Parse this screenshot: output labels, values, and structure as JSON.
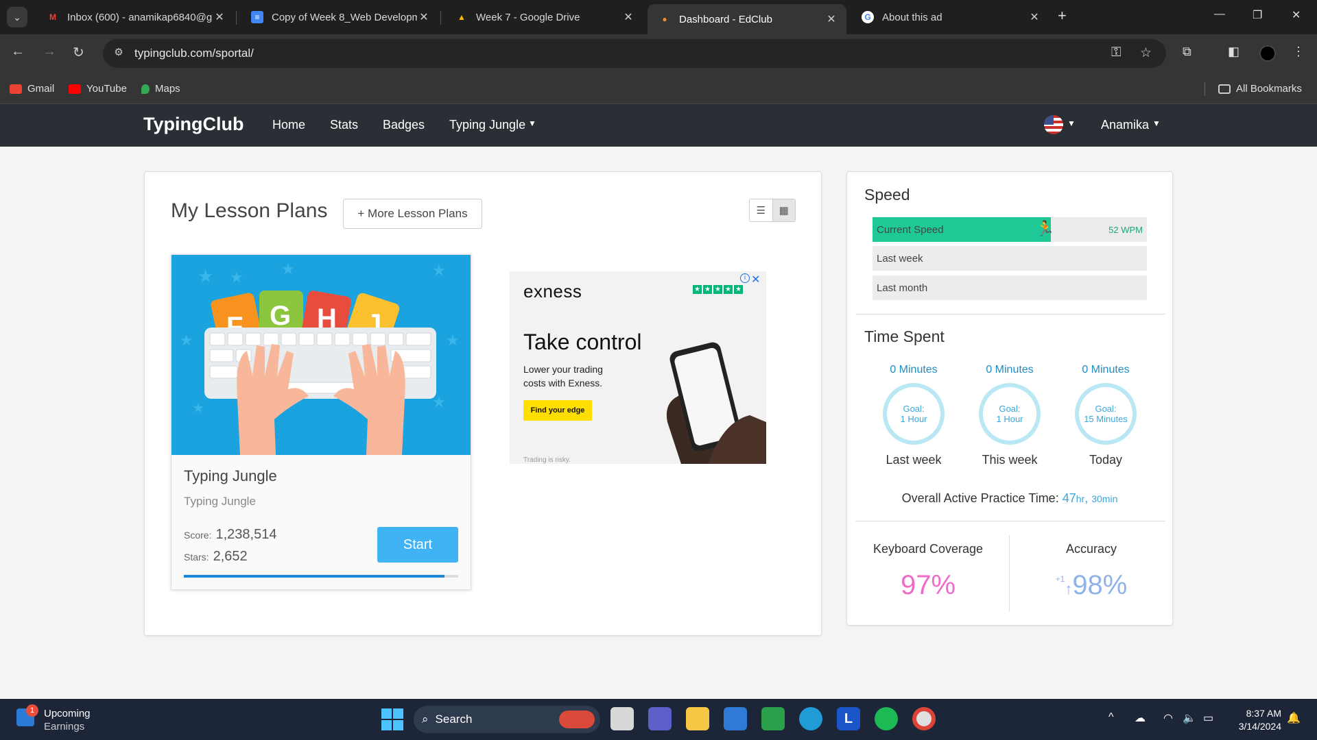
{
  "browser": {
    "tabs": [
      {
        "title": "Inbox (600) - anamikap6840@g",
        "icon": "gmail-icon"
      },
      {
        "title": "Copy of Week 8_Web Developm",
        "icon": "docs-icon"
      },
      {
        "title": "Week 7 - Google Drive",
        "icon": "drive-icon"
      },
      {
        "title": "Dashboard - EdClub",
        "icon": "edclub-icon",
        "active": true
      },
      {
        "title": "About this ad",
        "icon": "google-icon"
      }
    ],
    "url": "typingclub.com/sportal/",
    "bookmarks": [
      {
        "label": "Gmail"
      },
      {
        "label": "YouTube"
      },
      {
        "label": "Maps"
      }
    ],
    "all_bookmarks": "All Bookmarks"
  },
  "site": {
    "brand": "TypingClub",
    "nav": [
      "Home",
      "Stats",
      "Badges",
      "Typing Jungle"
    ],
    "user": "Anamika"
  },
  "lesson_plans": {
    "title": "My Lesson Plans",
    "more_button": "+ More Lesson Plans",
    "plan": {
      "name": "Typing Jungle",
      "subtitle": "Typing Jungle",
      "score_label": "Score:",
      "score": "1,238,514",
      "stars_label": "Stars:",
      "stars": "2,652",
      "start_button": "Start",
      "progress": 0.95,
      "tile_letters": [
        "F",
        "G",
        "H",
        "J"
      ]
    }
  },
  "ad": {
    "brand": "exness",
    "headline": "Take control",
    "text": "Lower your trading costs with Exness.",
    "cta": "Find your edge",
    "fine_print": "Trading is risky."
  },
  "speed": {
    "title": "Speed",
    "bars": [
      {
        "label": "Current Speed",
        "value": "52 WPM",
        "fill": 0.65
      },
      {
        "label": "Last week",
        "value": "",
        "fill": 0
      },
      {
        "label": "Last month",
        "value": "",
        "fill": 0
      }
    ]
  },
  "time_spent": {
    "title": "Time Spent",
    "columns": [
      {
        "minutes": "0 Minutes",
        "goal_label": "Goal:",
        "goal": "1 Hour",
        "label": "Last week"
      },
      {
        "minutes": "0 Minutes",
        "goal_label": "Goal:",
        "goal": "1 Hour",
        "label": "This week"
      },
      {
        "minutes": "0 Minutes",
        "goal_label": "Goal:",
        "goal": "15 Minutes",
        "label": "Today"
      }
    ],
    "overall_label": "Overall Active Practice Time:",
    "overall_hours": "47",
    "hours_unit": "hr",
    "overall_minutes": "30min"
  },
  "metrics": {
    "coverage_label": "Keyboard Coverage",
    "coverage_value": "97%",
    "coverage_color": "#f06ac8",
    "accuracy_label": "Accuracy",
    "accuracy_delta": "+1",
    "accuracy_value": "98%",
    "accuracy_color": "#8fb3e8"
  },
  "taskbar": {
    "widget_title": "Upcoming",
    "widget_sub": "Earnings",
    "widget_badge": "1",
    "search": "Search",
    "time": "8:37 AM",
    "date": "3/14/2024"
  }
}
